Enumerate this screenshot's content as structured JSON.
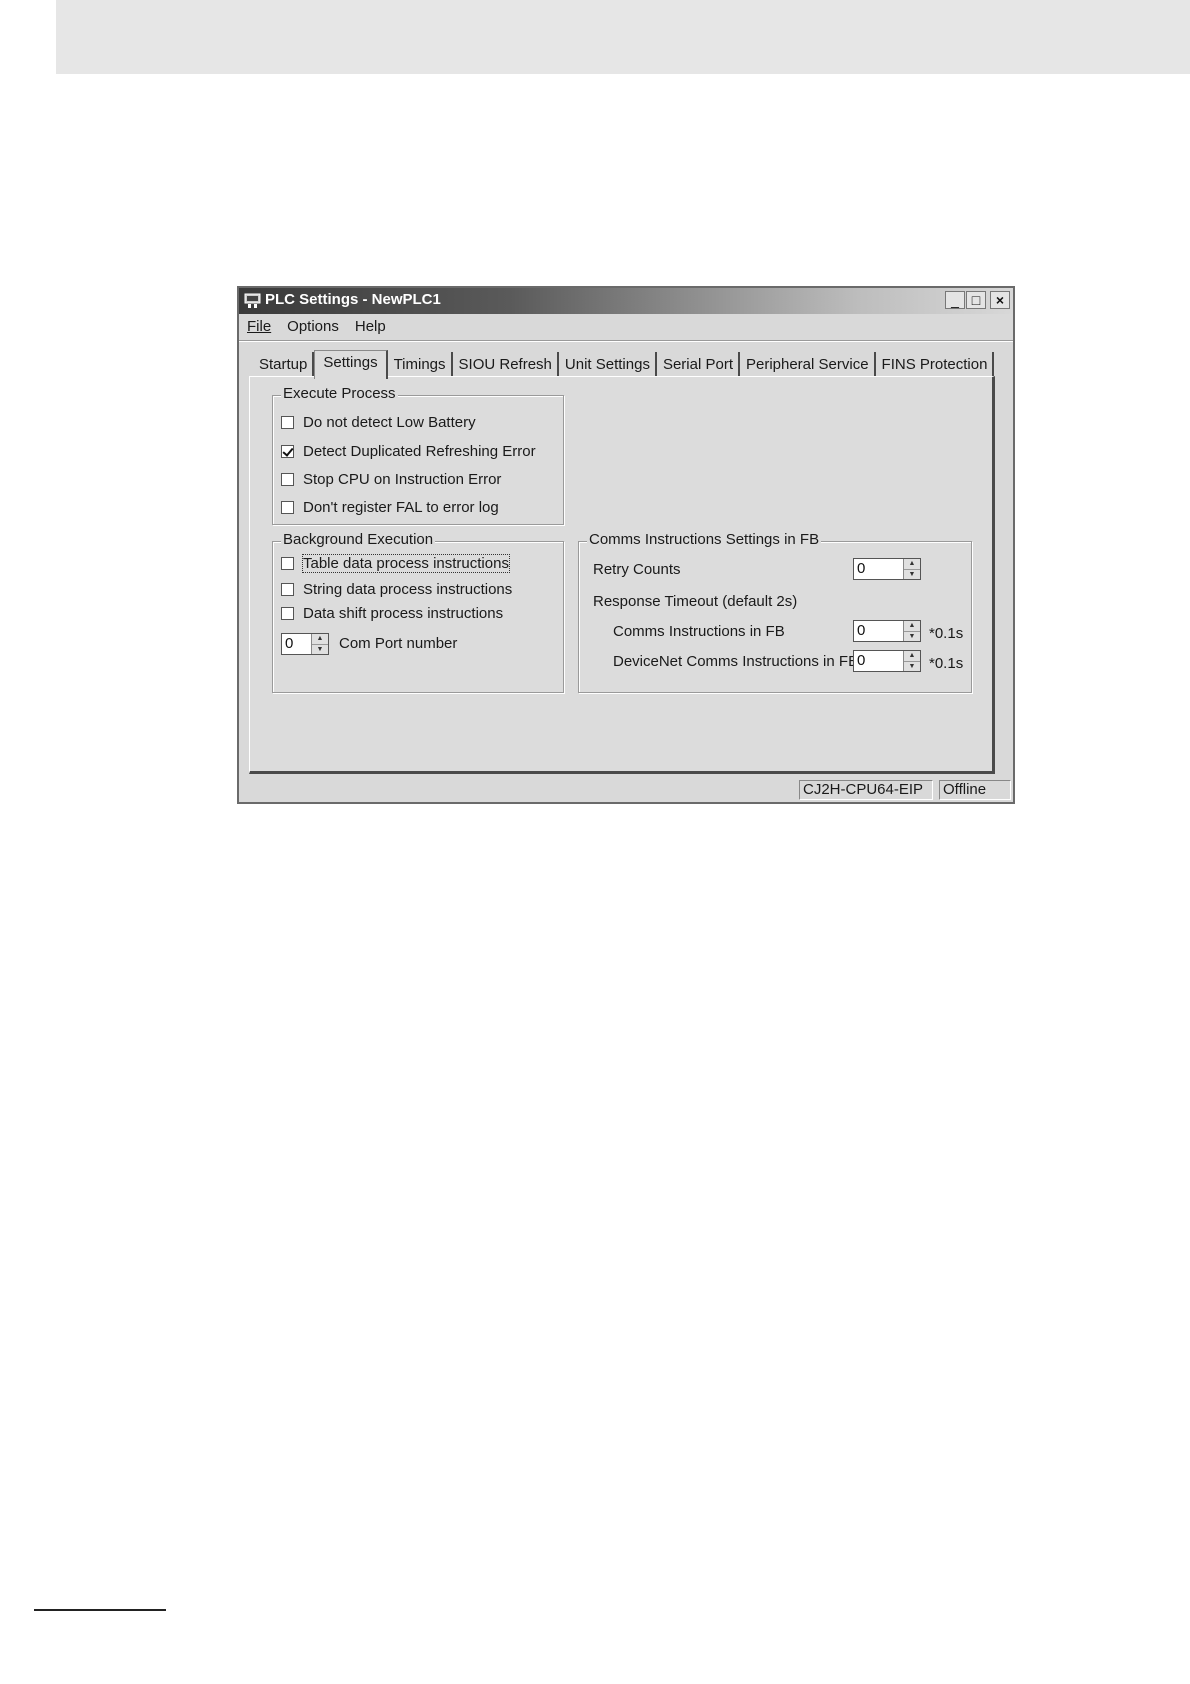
{
  "window": {
    "title": "PLC Settings - NewPLC1",
    "minimize": "_",
    "maximize": "□",
    "close": "×"
  },
  "menu": {
    "items": [
      {
        "label": "File"
      },
      {
        "label": "Options"
      },
      {
        "label": "Help"
      }
    ]
  },
  "tabs": [
    {
      "label": "Startup",
      "active": false
    },
    {
      "label": "Settings",
      "active": true
    },
    {
      "label": "Timings",
      "active": false
    },
    {
      "label": "SIOU Refresh",
      "active": false
    },
    {
      "label": "Unit Settings",
      "active": false
    },
    {
      "label": "Serial Port",
      "active": false
    },
    {
      "label": "Peripheral Service",
      "active": false
    },
    {
      "label": "FINS Protection",
      "active": false
    }
  ],
  "execute_process": {
    "legend": "Execute Process",
    "options": [
      {
        "label": "Do not detect Low Battery",
        "checked": false
      },
      {
        "label": "Detect Duplicated Refreshing Error",
        "checked": true
      },
      {
        "label": "Stop CPU on Instruction Error",
        "checked": false
      },
      {
        "label": "Don't register FAL to error log",
        "checked": false
      }
    ]
  },
  "background_execution": {
    "legend": "Background Execution",
    "options": [
      {
        "label": "Table data process instructions",
        "checked": false
      },
      {
        "label": "String data process instructions",
        "checked": false
      },
      {
        "label": "Data shift process instructions",
        "checked": false
      }
    ],
    "com_port": {
      "value": "0",
      "label": "Com Port number"
    }
  },
  "comms_fb": {
    "legend": "Comms Instructions Settings in FB",
    "retry_label": "Retry Counts",
    "retry_value": "0",
    "timeout_label": "Response Timeout (default 2s)",
    "comms_label": "Comms Instructions in FB",
    "comms_value": "0",
    "comms_unit": "*0.1s",
    "devicenet_label": "DeviceNet Comms Instructions in FB",
    "devicenet_value": "0",
    "devicenet_unit": "*0.1s"
  },
  "status": {
    "model": "CJ2H-CPU64-EIP",
    "mode": "Offline"
  },
  "icons": {
    "app": "plc-settings-icon",
    "spin_up": "▲",
    "spin_down": "▼"
  }
}
